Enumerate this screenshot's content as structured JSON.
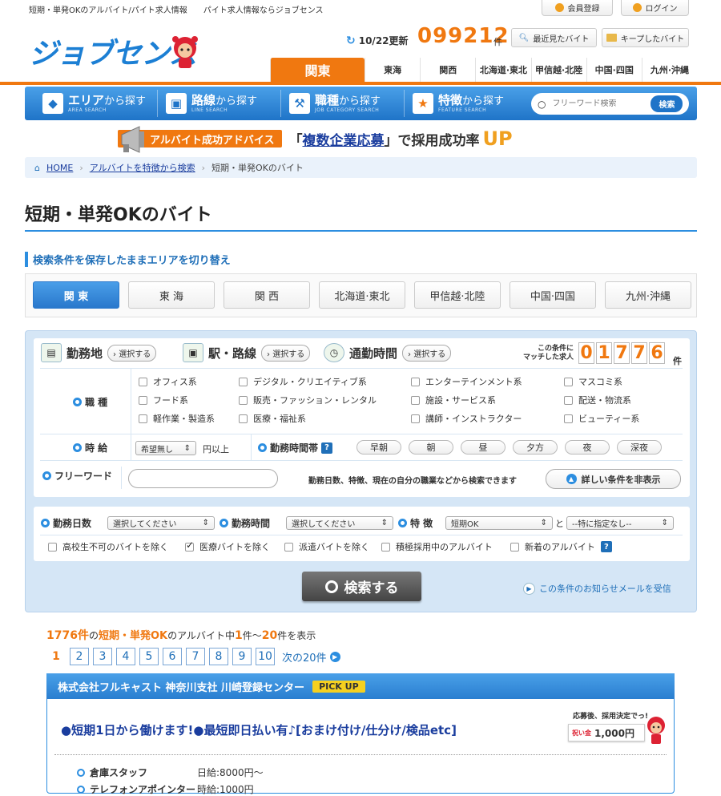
{
  "top": {
    "tagline": "短期・単発OKのアルバイト/パイト求人情報　　パイト求人情報ならジョブセンス",
    "register_label": "会員登録",
    "login_label": "ログイン"
  },
  "header": {
    "logo_text": "ジョブセンス",
    "update_label": "10/22更新",
    "job_count": "099212",
    "job_count_unit": "件",
    "recent_label": "最近見たバイト",
    "kept_label": "キープしたバイト",
    "regions": [
      "関東",
      "東海",
      "関西",
      "北海道·東北",
      "甲信越·北陸",
      "中国·四国",
      "九州·沖縄"
    ]
  },
  "nav": {
    "items": [
      {
        "big": "エリア",
        "rest": "から探す",
        "small": "AREA SEARCH"
      },
      {
        "big": "路線",
        "rest": "から探す",
        "small": "LINE SEARCH"
      },
      {
        "big": "職種",
        "rest": "から探す",
        "small": "JOB CATEGORY SEARCH"
      },
      {
        "big": "特徴",
        "rest": "から探す",
        "small": "FEATURE SEARCH"
      }
    ],
    "search_placeholder": "フリーワード検索",
    "search_button": "検索"
  },
  "banner": {
    "label": "アルバイト成功アドバイス",
    "open": "「",
    "link": "複数企業応募",
    "close": "」で採用成功率",
    "up": "UP"
  },
  "breadcrumb": {
    "home": "HOME",
    "level1": "アルバイトを特徴から検索",
    "current": "短期・単発OKのバイト"
  },
  "page": {
    "title": "短期・単発OKのバイト",
    "subhead": "検索条件を保存したままエリアを切り替え",
    "areas": [
      "関 東",
      "東 海",
      "関 西",
      "北海道·東北",
      "甲信越·北陸",
      "中国·四国",
      "九州·沖縄"
    ]
  },
  "search": {
    "crit_area": "勤務地",
    "crit_line": "駅・路線",
    "crit_time": "通勤時間",
    "select_label": "選択する",
    "match_line1": "この条件に",
    "match_line2": "マッチした求人",
    "match_digits": [
      "0",
      "1",
      "7",
      "7",
      "6"
    ],
    "match_unit": "件",
    "job_type_label": "職 種",
    "job_types": [
      [
        "オフィス系",
        "デジタル・クリエイティブ系",
        "エンターテインメント系",
        "マスコミ系"
      ],
      [
        "フード系",
        "販売・ファッション・レンタル",
        "施設・サービス系",
        "配送・物流系"
      ],
      [
        "軽作業・製造系",
        "医療・福祉系",
        "講師・インストラクター",
        "ビューティー系"
      ]
    ],
    "wage_label": "時 給",
    "wage_select": "希望無し",
    "wage_suffix": "円以上",
    "timeband_label": "勤務時間帯",
    "timebands": [
      "早朝",
      "朝",
      "昼",
      "夕方",
      "夜",
      "深夜"
    ],
    "freeword_label": "フリーワード",
    "freeword_value": "",
    "freeword_hint": "勤務日数、特徴、現在の自分の職業などから検索できます",
    "detail_toggle": "詳しい条件を非表示",
    "days_label": "勤務日数",
    "days_select": "選択してください",
    "hours_label": "勤務時間",
    "hours_select": "選択してください",
    "feature_label": "特 徴",
    "feature_select": "短期OK",
    "and_label": "と",
    "feature_select2": "--特に指定なし--",
    "exclude": [
      {
        "label": "高校生不可のバイトを除く",
        "checked": false
      },
      {
        "label": "医療バイトを除く",
        "checked": true
      },
      {
        "label": "派遣バイトを除く",
        "checked": false
      },
      {
        "label": "積極採用中のアルバイト",
        "checked": false
      },
      {
        "label": "新着のアルバイト",
        "checked": false
      }
    ],
    "submit": "検索する",
    "notify": "この条件のお知らせメールを受信"
  },
  "results": {
    "total": "1776件",
    "the": "の",
    "category": "短期・単発OK",
    "mid": "のアルバイト中",
    "from": "1",
    "sep": "件～",
    "to": "20",
    "end": "件を表示",
    "pages": [
      "1",
      "2",
      "3",
      "4",
      "5",
      "6",
      "7",
      "8",
      "9",
      "10"
    ],
    "next": "次の20件"
  },
  "card": {
    "company": "株式会社フルキャスト 神奈川支社 川崎登録センター",
    "pickup": "PICK UP",
    "title": "●短期1日から働けます!●最短即日払い有♪[おまけ付け/仕分け/検品etc]",
    "bonus_top": "応募後、採用決定でっ!",
    "bonus_label": "祝い金",
    "bonus_amount": "1,000円",
    "rows": [
      {
        "name": "倉庫スタッフ",
        "wage": "日給:8000円～"
      },
      {
        "name": "テレフォンアポインター",
        "wage": "時給:1000円"
      }
    ]
  },
  "colors": {
    "brand_blue": "#2c8ee0",
    "accent_orange": "#f07810"
  }
}
